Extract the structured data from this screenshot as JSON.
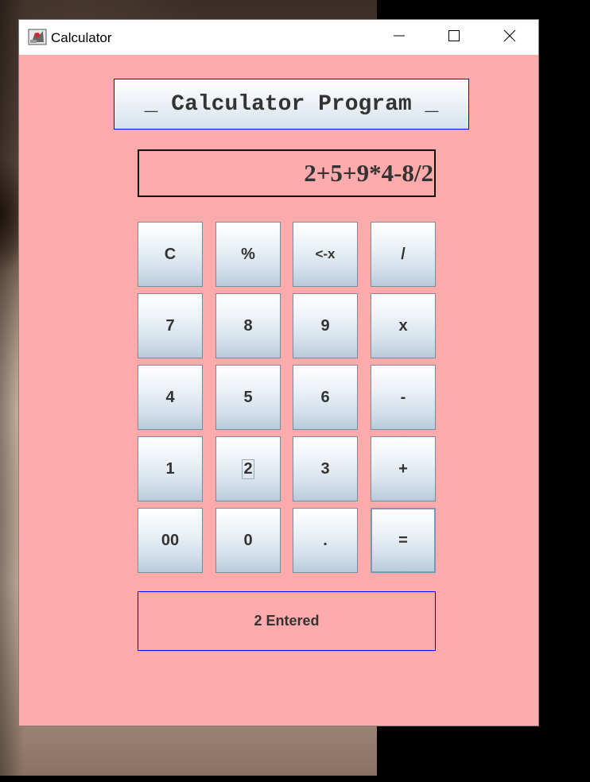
{
  "window": {
    "title": "Calculator",
    "app_icon": "java-duke-icon"
  },
  "titlebar_buttons": {
    "minimize_icon": "minimize-icon",
    "maximize_icon": "maximize-icon",
    "close_icon": "close-icon"
  },
  "heading": "_ Calculator Program _",
  "display": "2+5+9*4-8/2",
  "keys": [
    {
      "label": "C"
    },
    {
      "label": "%"
    },
    {
      "label": "<-x"
    },
    {
      "label": "/"
    },
    {
      "label": "7"
    },
    {
      "label": "8"
    },
    {
      "label": "9"
    },
    {
      "label": "x"
    },
    {
      "label": "4"
    },
    {
      "label": "5"
    },
    {
      "label": "6"
    },
    {
      "label": "-"
    },
    {
      "label": "1"
    },
    {
      "label": "2"
    },
    {
      "label": "3"
    },
    {
      "label": "+"
    },
    {
      "label": "00"
    },
    {
      "label": "0"
    },
    {
      "label": "."
    },
    {
      "label": "="
    }
  ],
  "status": "2 Entered",
  "colors": {
    "window_background": "#ffaaab",
    "heading_border": "#0000ff",
    "status_border": "#0000ff",
    "text": "#333333"
  }
}
